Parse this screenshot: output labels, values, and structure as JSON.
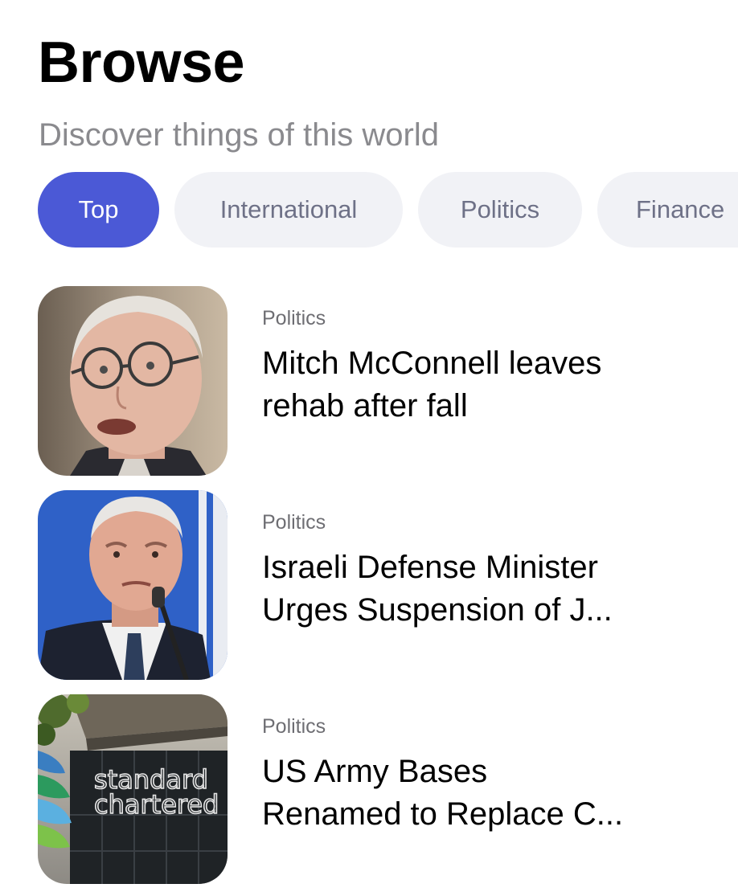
{
  "header": {
    "title": "Browse",
    "subtitle": "Discover things of this world"
  },
  "categories": [
    {
      "label": "Top",
      "active": true
    },
    {
      "label": "International",
      "active": false
    },
    {
      "label": "Politics",
      "active": false
    },
    {
      "label": "Finance",
      "active": false
    }
  ],
  "colors": {
    "accent": "#4b59d6",
    "chip_background": "#f1f2f6",
    "chip_text": "#6e7187",
    "subtitle_text": "#8a8a8e"
  },
  "articles": [
    {
      "category": "Politics",
      "title_line1": "Mitch McConnell leaves",
      "title_line2": "rehab after fall",
      "thumbnail": "older-man-glasses-photo"
    },
    {
      "category": "Politics",
      "title_line1": "Israeli Defense Minister",
      "title_line2": "Urges Suspension of J...",
      "thumbnail": "man-at-podium-photo"
    },
    {
      "category": "Politics",
      "title_line1": "US Army Bases",
      "title_line2": "Renamed to Replace C...",
      "thumbnail": "standard-chartered-building-photo",
      "thumbnail_text_line1": "standard",
      "thumbnail_text_line2": "chartered"
    }
  ]
}
